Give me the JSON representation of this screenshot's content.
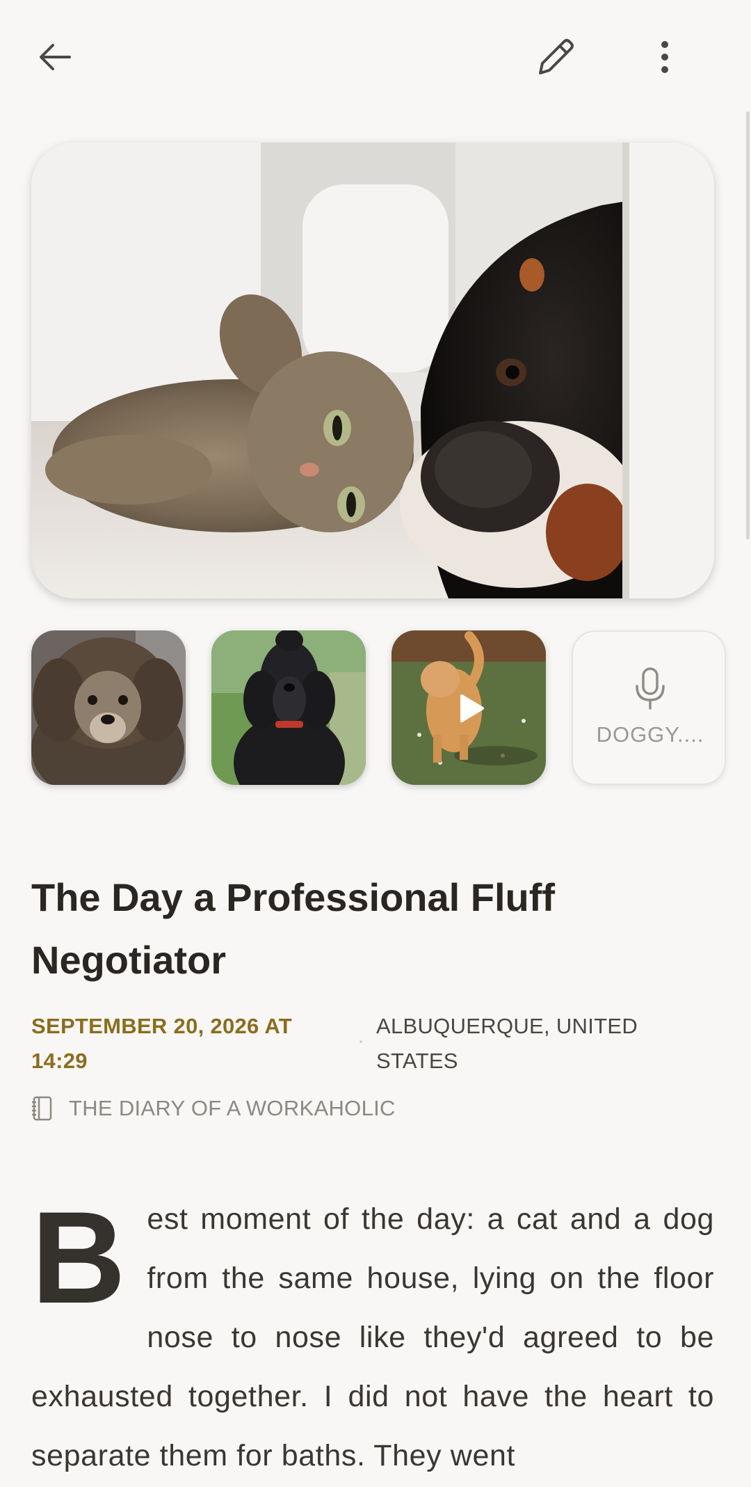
{
  "toolbar": {
    "back_icon": "back-arrow-icon",
    "edit_icon": "pencil-icon",
    "more_icon": "more-vertical-icon"
  },
  "hero": {
    "alt": "cat-and-dog-lying-nose-to-nose"
  },
  "media": {
    "thumbnails": [
      {
        "subject": "brown-poodle"
      },
      {
        "subject": "black-poodle"
      },
      {
        "subject": "orange-cat-video",
        "icon": "play-icon"
      }
    ],
    "audio": {
      "icon": "microphone-icon",
      "label": "DOGGY...."
    }
  },
  "entry": {
    "title": "The Day a Professional Fluff Negotiator",
    "date": "SEPTEMBER 20, 2026 AT 14:29",
    "location": "ALBUQUERQUE, UNITED STATES",
    "journal_icon": "notebook-icon",
    "journal": "THE DIARY OF A WORKAHOLIC",
    "drop_cap": "B",
    "body": "est moment of the day: a cat and a dog from the same house, lying on the floor nose to nose like they'd agreed to be exhausted together. I did not have the heart to separate them for baths. They went"
  },
  "colors": {
    "background": "#f8f7f5",
    "date_accent": "#8a6d1f",
    "title": "#2a2622"
  }
}
